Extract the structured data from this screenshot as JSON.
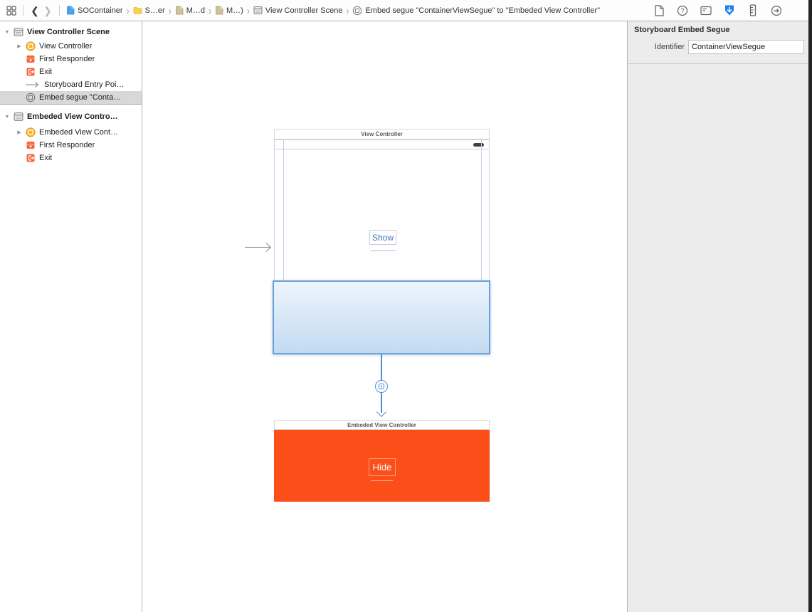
{
  "jumpbar": {
    "crumbs": [
      {
        "label": "SOContainer",
        "icon": "file-blue"
      },
      {
        "label": "S…er",
        "icon": "folder"
      },
      {
        "label": "M…d",
        "icon": "file-tan"
      },
      {
        "label": "M…)",
        "icon": "file-tan"
      },
      {
        "label": "View Controller Scene",
        "icon": "view-controller-scene"
      },
      {
        "label": "Embed segue \"ContainerViewSegue\" to \"Embeded View Controller\"",
        "icon": "segue"
      }
    ]
  },
  "sidebar": {
    "groups": [
      {
        "header": "View Controller Scene",
        "items": [
          {
            "label": "View Controller",
            "icon": "view-controller"
          },
          {
            "label": "First Responder",
            "icon": "first-responder"
          },
          {
            "label": "Exit",
            "icon": "exit"
          },
          {
            "label": "Storyboard Entry Poi…",
            "icon": "entry-arrow"
          },
          {
            "label": "Embed segue \"Conta…",
            "icon": "embed-segue",
            "selected": true
          }
        ]
      },
      {
        "header": "Embeded View Contro…",
        "items": [
          {
            "label": "Embeded View Cont…",
            "icon": "view-controller"
          },
          {
            "label": "First Responder",
            "icon": "first-responder"
          },
          {
            "label": "Exit",
            "icon": "exit"
          }
        ]
      }
    ]
  },
  "inspector": {
    "tabs": [
      "file",
      "quick-help",
      "identity",
      "attributes",
      "size",
      "connections"
    ],
    "selected_tab": "attributes",
    "section_title": "Storyboard Embed Segue",
    "identifier_label": "Identifier",
    "identifier_value": "ContainerViewSegue"
  },
  "canvas": {
    "top_vc": {
      "title": "View Controller",
      "button": "Show"
    },
    "bottom_vc": {
      "title": "Embeded View Controller",
      "button": "Hide"
    },
    "segue_type": "embed"
  },
  "colors": {
    "accent_blue": "#1e7ef7",
    "segue_blue": "#4a90d9",
    "embedded_orange": "#fb4e18",
    "container_gradient_top": "#ecf5fd",
    "container_gradient_bottom": "#c3daf1",
    "selection_gray": "#d8d8d8"
  }
}
